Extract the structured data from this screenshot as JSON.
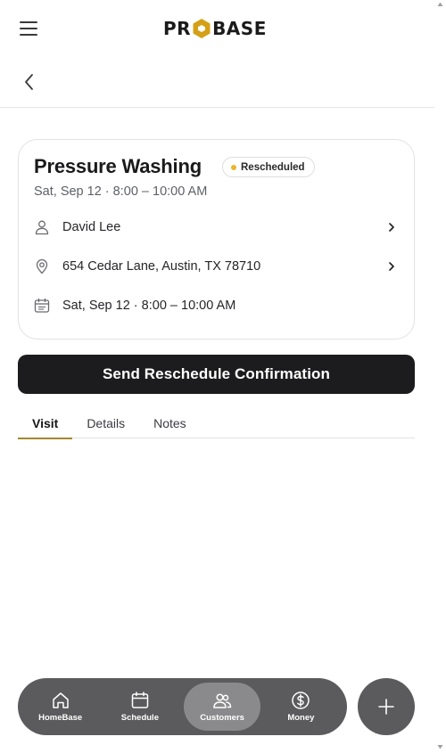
{
  "header": {
    "logo_text_left": "PR",
    "logo_text_right": "BASE"
  },
  "job": {
    "title": "Pressure Washing",
    "status": "Rescheduled",
    "status_color": "#e9b52b",
    "subtitle": "Sat, Sep 12 · 8:00 – 10:00 AM",
    "customer_name": "David Lee",
    "address": "654 Cedar Lane, Austin, TX 78710",
    "schedule": "Sat, Sep 12 · 8:00 – 10:00 AM"
  },
  "actions": {
    "primary_label": "Send Reschedule Confirmation"
  },
  "tabs": [
    {
      "label": "Visit",
      "active": true
    },
    {
      "label": "Details",
      "active": false
    },
    {
      "label": "Notes",
      "active": false
    }
  ],
  "bottom_nav": [
    {
      "label": "HomeBase",
      "icon": "home-icon",
      "active": false
    },
    {
      "label": "Schedule",
      "icon": "calendar-icon",
      "active": false
    },
    {
      "label": "Customers",
      "icon": "users-icon",
      "active": true
    },
    {
      "label": "Money",
      "icon": "dollar-icon",
      "active": false
    }
  ],
  "colors": {
    "accent": "#a5862d",
    "brand_logo": "#d4a017",
    "nav_bg": "#5b5b5d",
    "primary_btn": "#1c1c1e"
  }
}
